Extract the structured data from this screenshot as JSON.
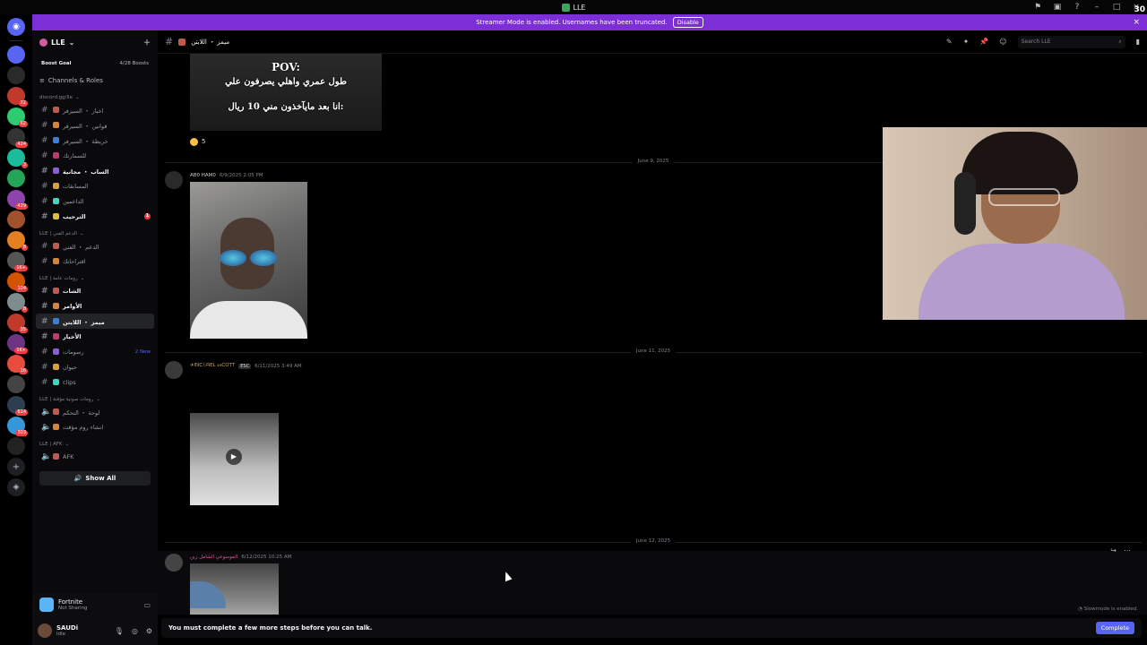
{
  "window": {
    "title": "LLE",
    "overlay_number": "30"
  },
  "banner": {
    "text": "Streamer Mode is enabled. Usernames have been truncated.",
    "disable_label": "Disable"
  },
  "rail": {
    "servers": [
      {
        "color": "#5865f2",
        "badge": ""
      },
      {
        "color": "#2a2a2a",
        "badge": ""
      },
      {
        "color": "#c0392b",
        "badge": "72"
      },
      {
        "color": "#2ecc71",
        "badge": "62"
      },
      {
        "color": "#333",
        "badge": "424"
      },
      {
        "color": "#1abc9c",
        "badge": "3"
      },
      {
        "color": "#23a55a",
        "badge": ""
      },
      {
        "color": "#8e44ad",
        "badge": "429"
      },
      {
        "color": "#a0522d",
        "badge": ""
      },
      {
        "color": "#e67e22",
        "badge": "8"
      },
      {
        "color": "#555",
        "badge": "1K+"
      },
      {
        "color": "#d35400",
        "badge": "104"
      },
      {
        "color": "#7f8c8d",
        "badge": "8"
      },
      {
        "color": "#c0392b",
        "badge": "35"
      },
      {
        "color": "#6c3483",
        "badge": "1K+"
      },
      {
        "color": "#e74c3c",
        "badge": "16"
      },
      {
        "color": "#444",
        "badge": ""
      },
      {
        "color": "#2c3e50",
        "badge": "614"
      },
      {
        "color": "#3498db",
        "badge": "303"
      },
      {
        "color": "#222",
        "badge": ""
      }
    ]
  },
  "sidebar": {
    "server_name": "LLE",
    "boost_goal": "Boost Goal",
    "boost_count": "4/28 Boosts",
    "channels_roles": "Channels & Roles",
    "category1": "discord.gg/lle",
    "channels1": [
      {
        "name": "اخبار ・ السيرفر",
        "bold": false
      },
      {
        "name": "قوانين ・ السيرفر",
        "bold": false
      },
      {
        "name": "خريطة ・ السيرفر",
        "bold": false
      },
      {
        "name": "للسمارتك",
        "bold": false
      },
      {
        "name": "الساب ・ مجانية",
        "bold": true
      },
      {
        "name": "المسابقات",
        "bold": false
      },
      {
        "name": "الداعمين",
        "bold": false
      },
      {
        "name": "الترحيب",
        "bold": true,
        "badge": "1"
      }
    ],
    "category2": "LLE | الدعم الفني",
    "channels2": [
      {
        "name": "الدعم ・ الفني",
        "bold": false
      },
      {
        "name": "اقتراحاتك",
        "bold": false
      }
    ],
    "category3": "LLE | رومات عامة",
    "channels3": [
      {
        "name": "الشات",
        "bold": true
      },
      {
        "name": "الأوامر",
        "bold": true
      },
      {
        "name": "ميمز ・ اللايتن",
        "bold": true,
        "active": true
      },
      {
        "name": "الأخبار",
        "bold": true
      },
      {
        "name": "رسومات",
        "bold": false,
        "new": "2 New"
      },
      {
        "name": "حيوان",
        "bold": false
      },
      {
        "name": "clips",
        "bold": false
      }
    ],
    "category4": "LLE | رومات صوتية مؤقتة",
    "channels4": [
      {
        "name": "لوحة ・ التحكم",
        "bold": false
      },
      {
        "name": "انشاء روم مؤقت",
        "bold": false
      }
    ],
    "category5": "LLE | AFK",
    "channels5": [
      {
        "name": "AFK",
        "bold": false
      }
    ],
    "show_all": "Show All"
  },
  "activity": {
    "game": "Fortnite",
    "status": "Not Sharing"
  },
  "user": {
    "name": "SAUDi",
    "status": "Idle"
  },
  "header": {
    "channel": "ميمز ・ اللايتن",
    "search_placeholder": "Search LLE"
  },
  "messages": {
    "image1_lines": [
      "POV:",
      "طول عمري واهلي يصرفون علي",
      "انا بعد مايآخذون مني 10 ريال:"
    ],
    "reaction_count": "5",
    "date1": "June 9, 2025",
    "msg2": {
      "author": "AB0 HAM0",
      "time": "6/9/2025 2:05 PM"
    },
    "date2": "June 11, 2025",
    "msg3": {
      "author": "✈ᗰIᑕᛕᗩEᒪ ᔕᑕOTT",
      "tag": "ESC",
      "time": "6/11/2025 3:49 AM"
    },
    "date3": "June 12, 2025",
    "msg4": {
      "author": "الموسوعي الشامل زين",
      "time": "6/12/2025 10:25 AM"
    }
  },
  "footer": {
    "slowmode": "Slowmode is enabled.",
    "notice": "You must complete a few more steps before you can talk.",
    "complete_label": "Complete"
  }
}
